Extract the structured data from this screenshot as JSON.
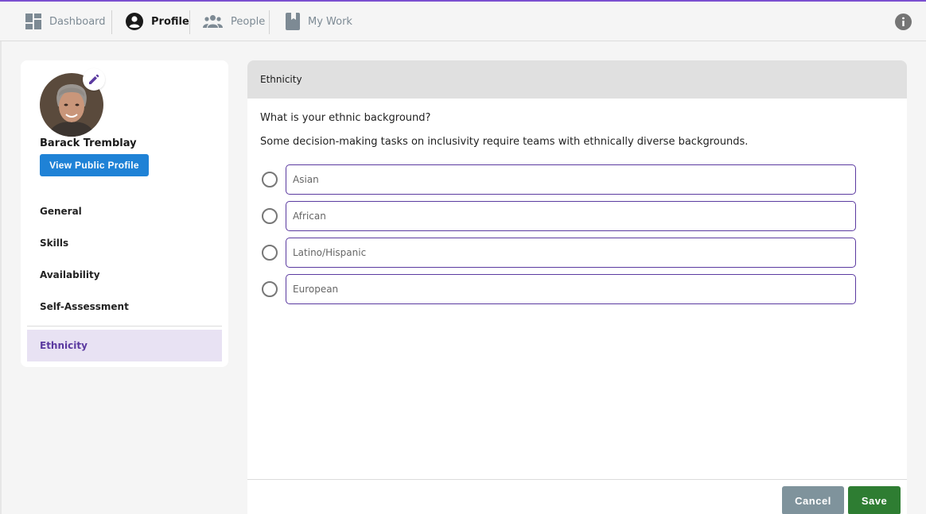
{
  "nav": {
    "items": [
      {
        "label": "Dashboard",
        "icon": "dashboard-icon",
        "active": false
      },
      {
        "label": "Profile",
        "icon": "account-circle-icon",
        "active": true
      },
      {
        "label": "People",
        "icon": "people-icon",
        "active": false
      },
      {
        "label": "My Work",
        "icon": "bookmark-book-icon",
        "active": false
      }
    ],
    "info_icon": "info-icon"
  },
  "profile": {
    "name": "Barack Tremblay",
    "view_public_label": "View Public Profile",
    "avatar_icon": "avatar-photo",
    "edit_icon": "pencil-icon"
  },
  "sidebar": {
    "items": [
      {
        "label": "General"
      },
      {
        "label": "Skills"
      },
      {
        "label": "Availability"
      },
      {
        "label": "Self-Assessment"
      },
      {
        "label": "Ethnicity",
        "selected": true
      }
    ]
  },
  "main": {
    "header": "Ethnicity",
    "question": "What is your ethnic background?",
    "description": "Some decision-making tasks on inclusivity require teams with ethnically diverse backgrounds.",
    "options": [
      "Asian",
      "African",
      "Latino/Hispanic",
      "European"
    ],
    "cancel_label": "Cancel",
    "save_label": "Save"
  },
  "colors": {
    "accent": "#5b3aa0",
    "primary_button": "#1f82d6",
    "save": "#2e7d32",
    "cancel": "#7f939c"
  }
}
